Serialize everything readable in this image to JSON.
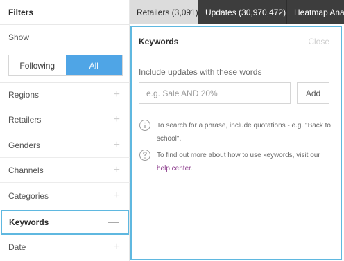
{
  "sidebar": {
    "title": "Filters",
    "show_label": "Show",
    "toggle": {
      "following": "Following",
      "all": "All"
    },
    "filters": [
      {
        "label": "Regions"
      },
      {
        "label": "Retailers"
      },
      {
        "label": "Genders"
      },
      {
        "label": "Channels"
      },
      {
        "label": "Categories"
      },
      {
        "label": "Keywords"
      },
      {
        "label": "Date"
      }
    ],
    "plus_symbol": "+",
    "minus_symbol": "—"
  },
  "tabs": [
    {
      "label": "Retailers (3,091)"
    },
    {
      "label": "Updates (30,970,472)"
    },
    {
      "label": "Heatmap Analysis"
    }
  ],
  "panel": {
    "title": "Keywords",
    "close": "Close",
    "include_label": "Include updates with these words",
    "input_placeholder": "e.g. Sale AND 20%",
    "add_label": "Add",
    "tip1": "To search for a phrase, include quotations - e.g. \"Back to school\".",
    "tip2_prefix": "To find out more about how to use keywords, visit our ",
    "tip2_link": "help center",
    "tip2_suffix": "."
  },
  "colors": {
    "accent": "#4fa5e6",
    "highlight_border": "#5fb8e0",
    "tab_bar": "#3d3d3d",
    "link": "#8e3f8e"
  }
}
